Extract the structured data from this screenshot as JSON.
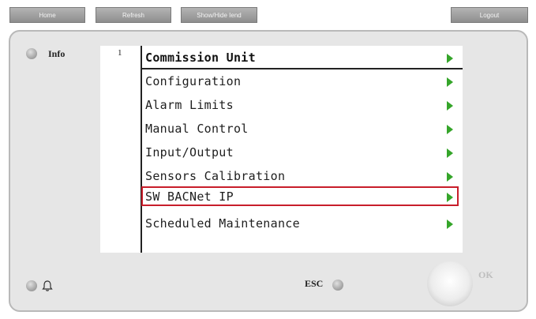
{
  "toolbar": {
    "home_label": "Home",
    "refresh_label": "Refresh",
    "showhide_label": "Show/Hide Iend",
    "logout_label": "Logout"
  },
  "panel": {
    "info_label": "Info",
    "esc_label": "ESC",
    "ok_label": "OK"
  },
  "screen": {
    "page_number": "1",
    "title": "Commission Unit",
    "selected_item": "SW BACNet IP",
    "items": [
      {
        "label": "Configuration"
      },
      {
        "label": "Alarm Limits"
      },
      {
        "label": "Manual Control"
      },
      {
        "label": "Input/Output"
      },
      {
        "label": "Sensors Calibration"
      },
      {
        "label": "SW BACNet IP"
      },
      {
        "label": "Scheduled Maintenance"
      }
    ]
  },
  "icons": {
    "arrow": "right-triangle-icon",
    "bell": "bell-icon",
    "leds": "status-led-icon"
  },
  "colors": {
    "arrow": "#35a52a",
    "highlight": "#c81e2b",
    "toolbar_button": "#a0a0a0",
    "panel_background": "#e6e6e6"
  }
}
